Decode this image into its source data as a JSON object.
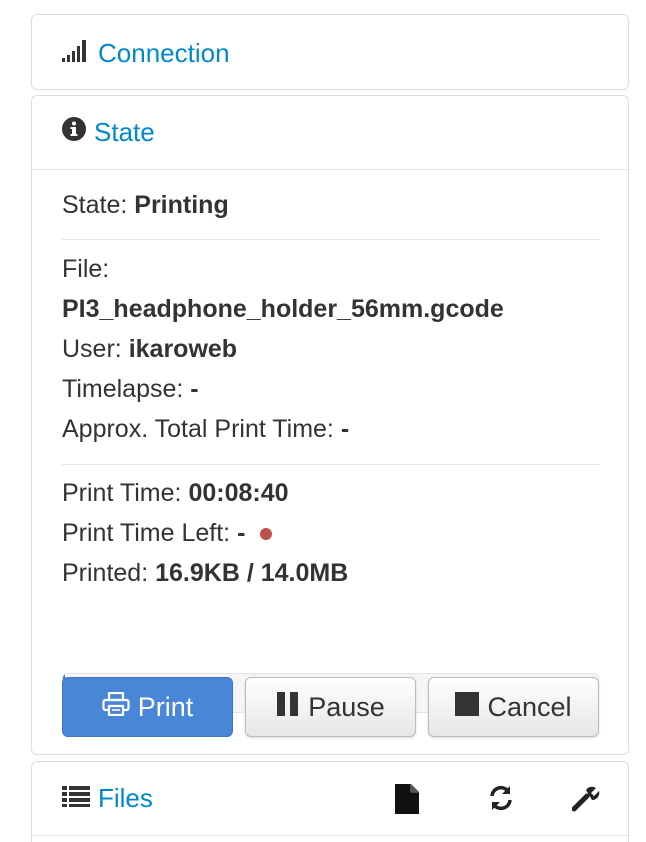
{
  "connection": {
    "title": "Connection",
    "icon": "signal-icon"
  },
  "state_panel": {
    "title": "State",
    "icon": "info-icon",
    "state_label": "State:",
    "state_value": "Printing",
    "file_label": "File:",
    "file_value": "PI3_headphone_holder_56mm.gcode",
    "user_label": "User:",
    "user_value": "ikaroweb",
    "timelapse_label": "Timelapse:",
    "timelapse_value": "-",
    "approx_label": "Approx. Total Print Time:",
    "approx_value": "-",
    "print_time_label": "Print Time:",
    "print_time_value": "00:08:40",
    "time_left_label": "Print Time Left:",
    "time_left_value": "-",
    "time_left_indicator_color": "#c0504d",
    "printed_label": "Printed:",
    "printed_value": "16.9KB / 14.0MB",
    "progress_text": "0%",
    "progress_fraction": 0.003
  },
  "buttons": {
    "print": "Print",
    "pause": "Pause",
    "cancel": "Cancel"
  },
  "files": {
    "title": "Files",
    "icon": "list-icon",
    "tools": [
      "file-icon",
      "refresh-icon",
      "wrench-icon"
    ]
  },
  "colors": {
    "link": "#0088cc",
    "primary": "#4a86d8",
    "progress": "#3a87ad"
  }
}
